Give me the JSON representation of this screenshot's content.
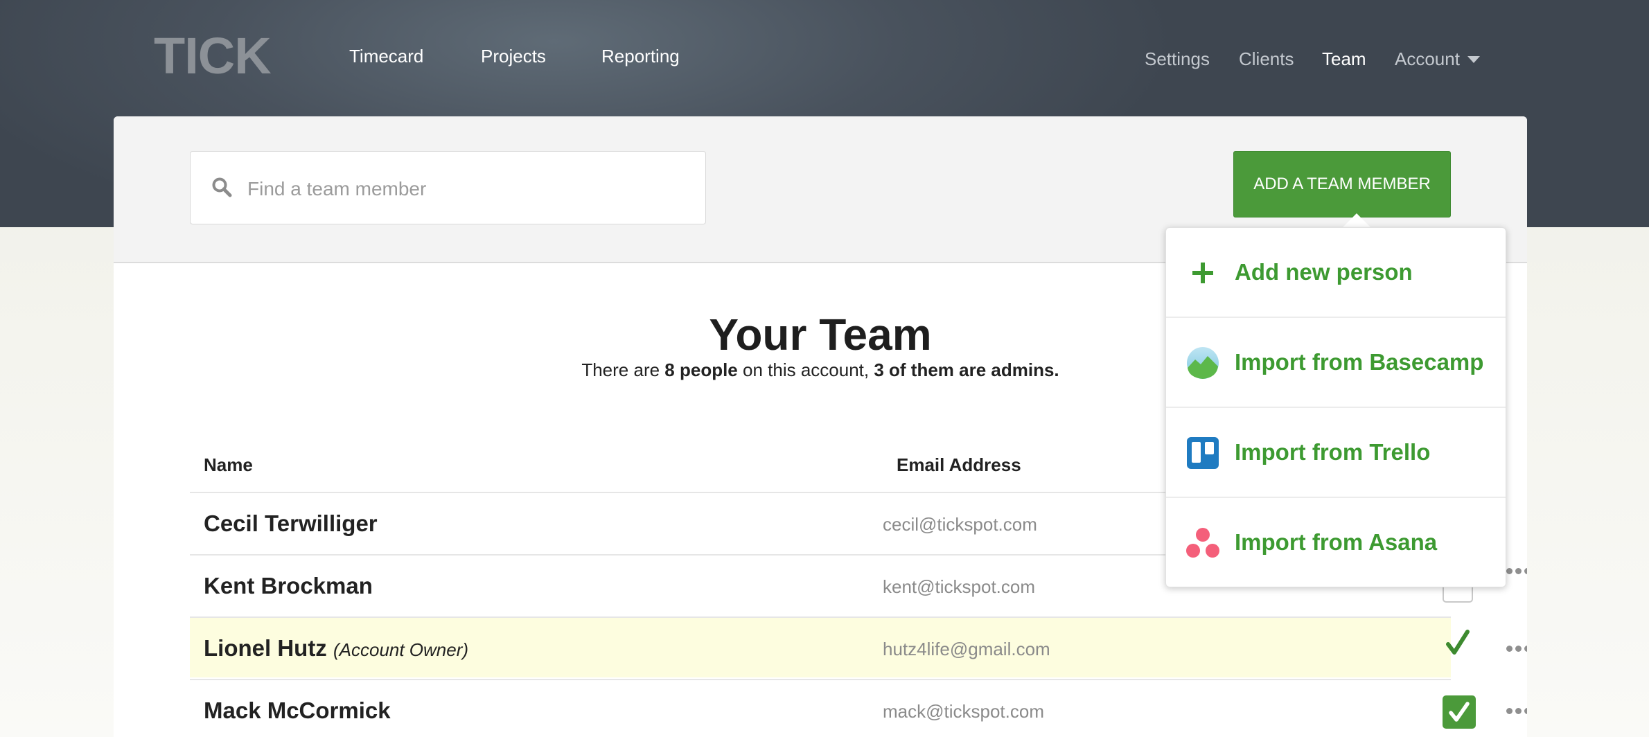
{
  "brand": {
    "logo_text": "TICK"
  },
  "nav": {
    "main": [
      "Timecard",
      "Projects",
      "Reporting"
    ],
    "right": [
      "Settings",
      "Clients",
      "Team",
      "Account"
    ],
    "active": "Team"
  },
  "search": {
    "placeholder": "Find a team member",
    "value": ""
  },
  "add_button": {
    "label": "ADD A TEAM MEMBER"
  },
  "dropdown": {
    "items": [
      {
        "label": "Add new person",
        "icon": "plus-icon"
      },
      {
        "label": "Import from Basecamp",
        "icon": "basecamp-icon"
      },
      {
        "label": "Import from Trello",
        "icon": "trello-icon"
      },
      {
        "label": "Import from Asana",
        "icon": "asana-icon"
      }
    ]
  },
  "page": {
    "title": "Your Team",
    "summary": {
      "prefix": "There are ",
      "people": "8 people",
      "middle": " on this account, ",
      "admins": "3 of them are admins."
    }
  },
  "table": {
    "headers": {
      "name": "Name",
      "email": "Email Address"
    },
    "rows": [
      {
        "name": "Cecil Terwilliger",
        "note": "",
        "email": "cecil@tickspot.com",
        "admin": null
      },
      {
        "name": "Kent Brockman",
        "note": "",
        "email": "kent@tickspot.com",
        "admin": false
      },
      {
        "name": "Lionel Hutz",
        "note": "(Account Owner)",
        "email": "hutz4life@gmail.com",
        "admin": "owner"
      },
      {
        "name": "Mack McCormick",
        "note": "",
        "email": "mack@tickspot.com",
        "admin": true
      }
    ]
  },
  "colors": {
    "accent_green": "#4b9a3a",
    "link_green": "#3d9a31",
    "header_bg": "#49525d",
    "owner_row_bg": "#fdfddf"
  }
}
